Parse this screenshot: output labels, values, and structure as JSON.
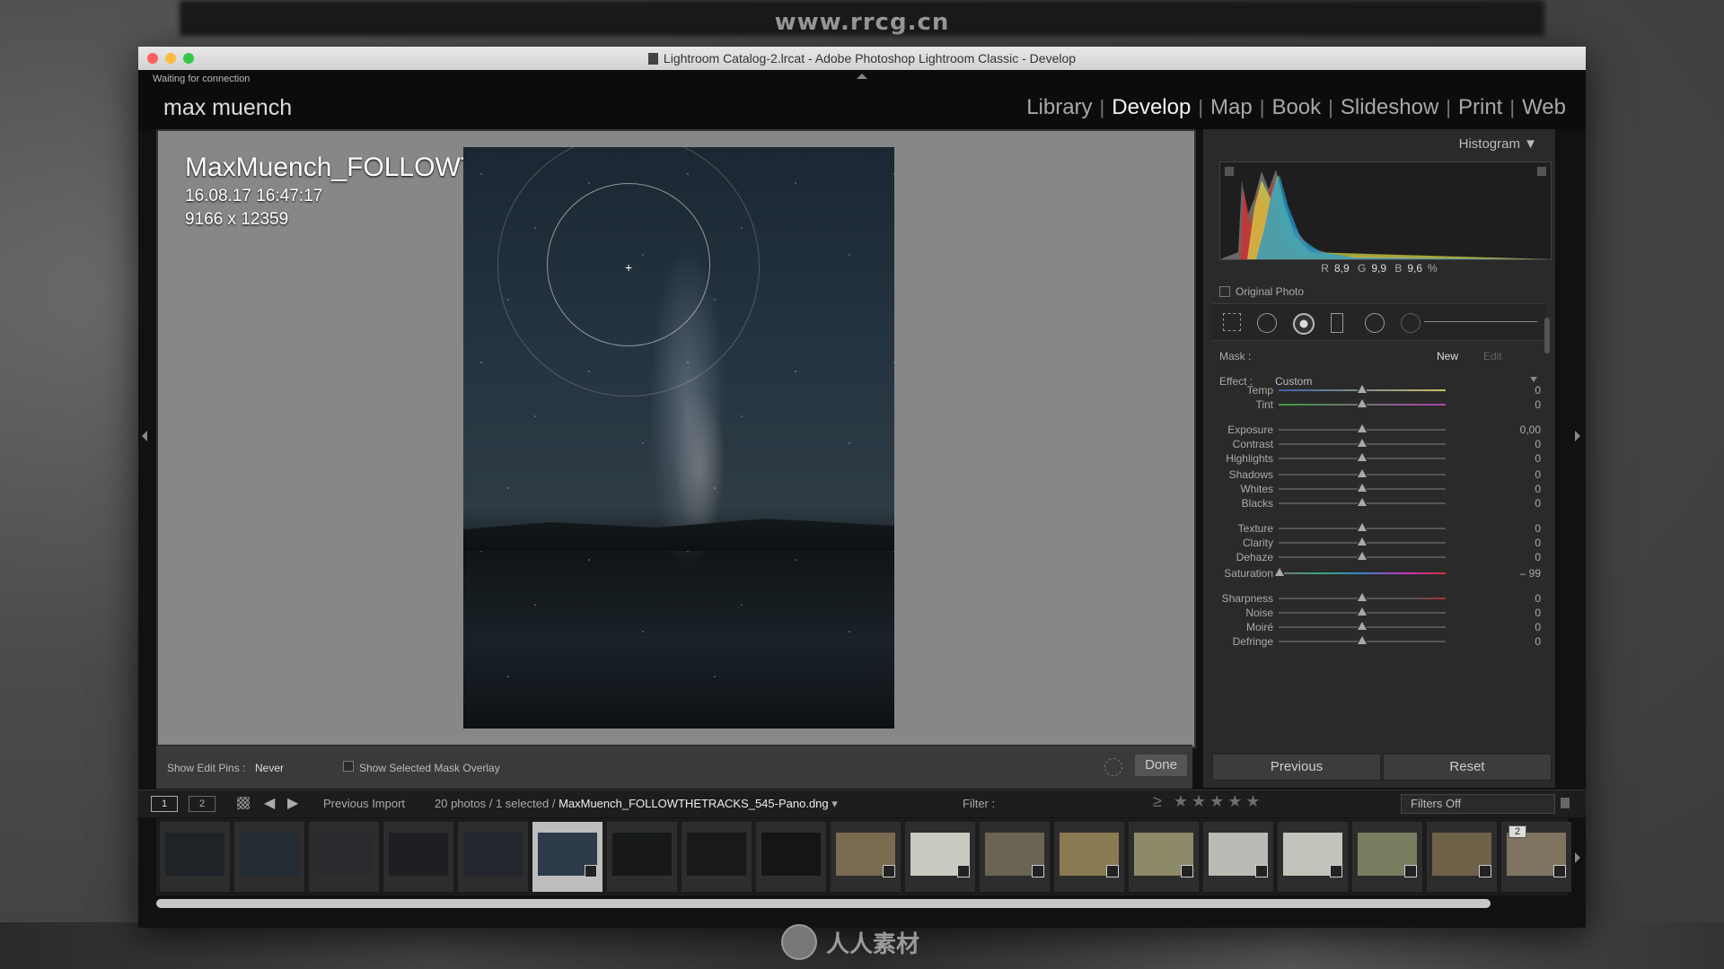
{
  "watermark": {
    "top": "www.rrcg.cn",
    "bottom": "人人素材"
  },
  "window": {
    "title": "Lightroom Catalog-2.lrcat - Adobe Photoshop Lightroom Classic - Develop"
  },
  "identity": {
    "status": "Waiting for connection",
    "brand": "max muench",
    "modules": [
      "Library",
      "Develop",
      "Map",
      "Book",
      "Slideshow",
      "Print",
      "Web"
    ],
    "active_module": "Develop"
  },
  "photo_info": {
    "filename": "MaxMuench_FOLLOWTHETRACKS_545-Pano.dng",
    "datetime": "16.08.17 16:47:17",
    "dimensions": "9166 x 12359"
  },
  "toolbar": {
    "show_edit_pins_label": "Show Edit Pins :",
    "show_edit_pins_value": "Never",
    "mask_overlay_label": "Show Selected Mask Overlay",
    "done_label": "Done"
  },
  "right_panel": {
    "histogram_label": "Histogram",
    "rgb": {
      "r_label": "R",
      "r": "8,9",
      "g_label": "G",
      "g": "9,9",
      "b_label": "B",
      "b": "9,6",
      "unit": "%"
    },
    "original_photo_label": "Original Photo",
    "mask_label": "Mask :",
    "mask_new": "New",
    "mask_edit": "Edit",
    "effect_label": "Effect :",
    "effect_value": "Custom",
    "sliders": [
      {
        "label": "Temp",
        "value": "0",
        "pos": 0.5
      },
      {
        "label": "Tint",
        "value": "0",
        "pos": 0.5
      },
      {
        "label": "Exposure",
        "value": "0,00",
        "pos": 0.5
      },
      {
        "label": "Contrast",
        "value": "0",
        "pos": 0.5
      },
      {
        "label": "Highlights",
        "value": "0",
        "pos": 0.5
      },
      {
        "label": "Shadows",
        "value": "0",
        "pos": 0.5
      },
      {
        "label": "Whites",
        "value": "0",
        "pos": 0.5
      },
      {
        "label": "Blacks",
        "value": "0",
        "pos": 0.5
      },
      {
        "label": "Texture",
        "value": "0",
        "pos": 0.5
      },
      {
        "label": "Clarity",
        "value": "0",
        "pos": 0.5
      },
      {
        "label": "Dehaze",
        "value": "0",
        "pos": 0.5
      },
      {
        "label": "Saturation",
        "value": "– 99",
        "pos": 0.005
      },
      {
        "label": "Sharpness",
        "value": "0",
        "pos": 0.5
      },
      {
        "label": "Noise",
        "value": "0",
        "pos": 0.5
      },
      {
        "label": "Moiré",
        "value": "0",
        "pos": 0.5
      },
      {
        "label": "Defringe",
        "value": "0",
        "pos": 0.5
      }
    ],
    "previous_label": "Previous",
    "reset_label": "Reset"
  },
  "filmstrip_bar": {
    "view1": "1",
    "view2": "2",
    "source": "Previous Import",
    "count": "20 photos / 1 selected /",
    "selected_file": "MaxMuench_FOLLOWTHETRACKS_545-Pano.dng",
    "filter_label": "Filter :",
    "stars": "≥ ★★★★★",
    "filters_off": "Filters Off"
  },
  "filmstrip": {
    "selected_index": 5,
    "stack_count": "2",
    "thumb_colors": [
      "#1f2328",
      "#252b33",
      "#2a2b2e",
      "#1e1f22",
      "#23262c",
      "#2c3a4a",
      "#16181a",
      "#18191b",
      "#141516",
      "#7a6a50",
      "#c9c9c2",
      "#6a6452",
      "#8a7a52",
      "#8c8a68",
      "#b8bcb4",
      "#c2c4bc",
      "#7a7c60",
      "#6e6248",
      "#7f7460"
    ]
  }
}
